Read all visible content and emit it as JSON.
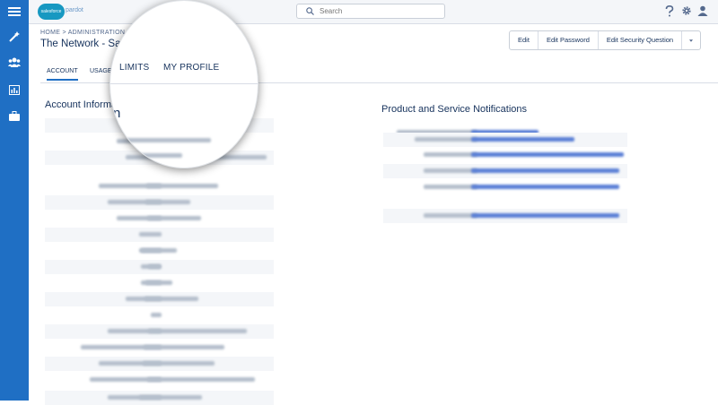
{
  "sidebar": {
    "items": [
      {
        "icon": "menu-icon"
      },
      {
        "icon": "magic-wand-icon"
      },
      {
        "icon": "users-icon"
      },
      {
        "icon": "reports-icon"
      },
      {
        "icon": "briefcase-icon"
      }
    ]
  },
  "topbar": {
    "logo_brand": "salesforce",
    "logo_product": "pardot",
    "search_placeholder": "Search",
    "help_icon": "help-icon",
    "settings_icon": "gear-icon",
    "user_icon": "user-icon"
  },
  "header": {
    "breadcrumb": "HOME > ADMINISTRATION",
    "title": "The Network - Sandi",
    "buttons": {
      "edit": "Edit",
      "edit_password": "Edit Password",
      "edit_security_question": "Edit Security Question",
      "more_icon": "caret-down-icon"
    }
  },
  "tabs": {
    "account": "ACCOUNT",
    "usage": "USAGE &",
    "limits": "LIMITS",
    "my_profile": "MY PROFILE"
  },
  "account_section": {
    "title": "Account Information"
  },
  "notifications_section": {
    "title": "Product and Service Notifications"
  },
  "magnifier": {
    "tab_limits": "LIMITS",
    "tab_my_profile": "MY PROFILE",
    "heading_fragment": "n"
  },
  "colors": {
    "sidebar": "#1f6fc4",
    "accent": "#1f6fc4",
    "text": "#16325c"
  }
}
